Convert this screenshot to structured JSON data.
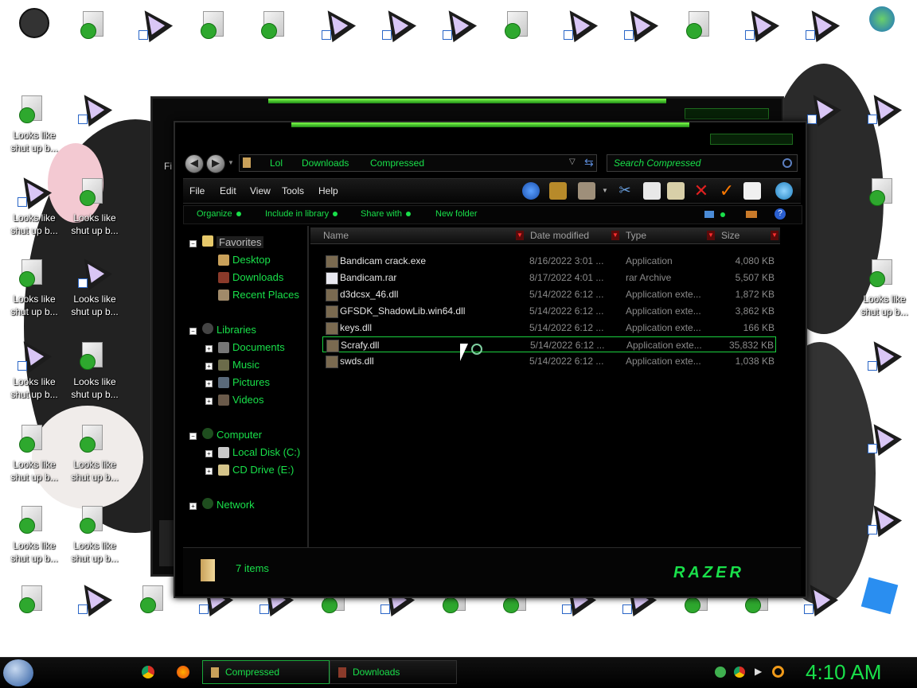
{
  "desktop": {
    "label": "Looks like shut up b..."
  },
  "explorer": {
    "address": {
      "crumbs": [
        "Lol",
        "Downloads",
        "Compressed"
      ]
    },
    "search_placeholder": "Search Compressed",
    "menu": [
      "File",
      "Edit",
      "View",
      "Tools",
      "Help"
    ],
    "commands": {
      "organize": "Organize",
      "include": "Include in library",
      "share": "Share with",
      "new_folder": "New folder"
    },
    "nav": {
      "favorites": "Favorites",
      "desktop": "Desktop",
      "downloads": "Downloads",
      "recent": "Recent Places",
      "libraries": "Libraries",
      "documents": "Documents",
      "music": "Music",
      "pictures": "Pictures",
      "videos": "Videos",
      "computer": "Computer",
      "local_disk": "Local Disk (C:)",
      "cd_drive": "CD Drive (E:)",
      "network": "Network"
    },
    "columns": {
      "name": "Name",
      "date": "Date modified",
      "type": "Type",
      "size": "Size"
    },
    "files": [
      {
        "name": "Bandicam crack.exe",
        "date": "8/16/2022 3:01 ...",
        "type": "Application",
        "size": "4,080 KB"
      },
      {
        "name": "Bandicam.rar",
        "date": "8/17/2022 4:01 ...",
        "type": "rar Archive",
        "size": "5,507 KB"
      },
      {
        "name": "d3dcsx_46.dll",
        "date": "5/14/2022 6:12 ...",
        "type": "Application exte...",
        "size": "1,872 KB"
      },
      {
        "name": "GFSDK_ShadowLib.win64.dll",
        "date": "5/14/2022 6:12 ...",
        "type": "Application exte...",
        "size": "3,862 KB"
      },
      {
        "name": "keys.dll",
        "date": "5/14/2022 6:12 ...",
        "type": "Application exte...",
        "size": "166 KB"
      },
      {
        "name": "Scrafy.dll",
        "date": "5/14/2022 6:12 ...",
        "type": "Application exte...",
        "size": "35,832 KB"
      },
      {
        "name": "swds.dll",
        "date": "5/14/2022 6:12 ...",
        "type": "Application exte...",
        "size": "1,038 KB"
      }
    ],
    "status_count": "7 items",
    "brand": "RAZER",
    "back_window_menu": "Fi"
  },
  "taskbar": {
    "tasks": [
      "Compressed",
      "Downloads"
    ],
    "clock": "4:10 AM"
  },
  "colors": {
    "accent": "#19e04a",
    "window_bg": "#000000",
    "selection_border": "#1bd13f"
  }
}
